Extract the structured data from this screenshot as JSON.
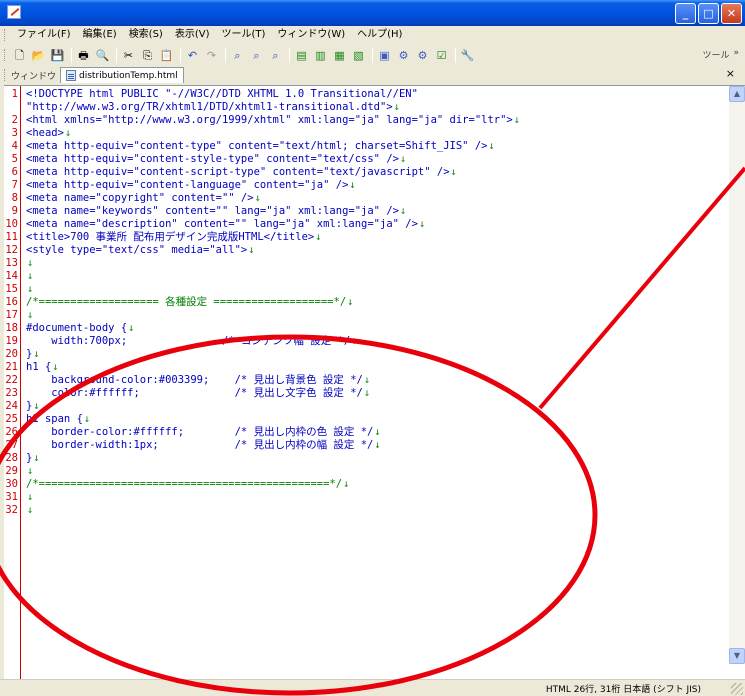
{
  "menu": [
    "ファイル(F)",
    "編集(E)",
    "検索(S)",
    "表示(V)",
    "ツール(T)",
    "ウィンドウ(W)",
    "ヘルプ(H)"
  ],
  "toolbar": {
    "right_label": "ツール",
    "right_more": "»"
  },
  "tabbar": {
    "label": "ウィンドウ",
    "tab_title": "distributionTemp.html",
    "close": "×"
  },
  "editor_lines": [
    {
      "n": "1",
      "t": "<!DOCTYPE html PUBLIC \"-//W3C//DTD XHTML 1.0 Transitional//EN\"",
      "eol": ""
    },
    {
      "n": "",
      "t": "\"http://www.w3.org/TR/xhtml1/DTD/xhtml1-transitional.dtd\">",
      "eol": "↓"
    },
    {
      "n": "2",
      "t": "<html xmlns=\"http://www.w3.org/1999/xhtml\" xml:lang=\"ja\" lang=\"ja\" dir=\"ltr\">",
      "eol": "↓"
    },
    {
      "n": "3",
      "t": "<head>",
      "eol": "↓"
    },
    {
      "n": "4",
      "t": "<meta http-equiv=\"content-type\" content=\"text/html; charset=Shift_JIS\" />",
      "eol": "↓"
    },
    {
      "n": "5",
      "t": "<meta http-equiv=\"content-style-type\" content=\"text/css\" />",
      "eol": "↓"
    },
    {
      "n": "6",
      "t": "<meta http-equiv=\"content-script-type\" content=\"text/javascript\" />",
      "eol": "↓"
    },
    {
      "n": "7",
      "t": "<meta http-equiv=\"content-language\" content=\"ja\" />",
      "eol": "↓"
    },
    {
      "n": "8",
      "t": "<meta name=\"copyright\" content=\"\" />",
      "eol": "↓"
    },
    {
      "n": "9",
      "t": "<meta name=\"keywords\" content=\"\" lang=\"ja\" xml:lang=\"ja\" />",
      "eol": "↓"
    },
    {
      "n": "10",
      "t": "<meta name=\"description\" content=\"\" lang=\"ja\" xml:lang=\"ja\" />",
      "eol": "↓"
    },
    {
      "n": "11",
      "t": "<title>700 事業所 配布用デザイン完成版HTML</title>",
      "eol": "↓"
    },
    {
      "n": "12",
      "t": "<style type=\"text/css\" media=\"all\">",
      "eol": "↓"
    },
    {
      "n": "13",
      "t": "",
      "eol": "↓"
    },
    {
      "n": "14",
      "t": "",
      "eol": "↓"
    },
    {
      "n": "15",
      "t": "",
      "eol": "↓"
    },
    {
      "n": "16",
      "t": "/*=================== 各種設定 ===================*/",
      "eol": "↓"
    },
    {
      "n": "17",
      "t": "",
      "eol": "↓"
    },
    {
      "n": "18",
      "t": "#document-body {",
      "eol": "↓"
    },
    {
      "n": "19",
      "t": "    width:700px;               /* コンテンツ幅 設定 */",
      "eol": "↓"
    },
    {
      "n": "20",
      "t": "}",
      "eol": "↓"
    },
    {
      "n": "21",
      "t": "h1 {",
      "eol": "↓"
    },
    {
      "n": "22",
      "t": "    background-color:#003399;    /* 見出し背景色 設定 */",
      "eol": "↓"
    },
    {
      "n": "23",
      "t": "    color:#ffffff;               /* 見出し文字色 設定 */",
      "eol": "↓"
    },
    {
      "n": "24",
      "t": "}",
      "eol": "↓"
    },
    {
      "n": "25",
      "t": "h1 span {",
      "eol": "↓"
    },
    {
      "n": "26",
      "t": "    border-color:#ffffff;        /* 見出し内枠の色 設定 */",
      "eol": "↓"
    },
    {
      "n": "27",
      "t": "    border-width:1px;            /* 見出し内枠の幅 設定 */",
      "eol": "↓"
    },
    {
      "n": "28",
      "t": "}",
      "eol": "↓"
    },
    {
      "n": "29",
      "t": "",
      "eol": "↓"
    },
    {
      "n": "30",
      "t": "/*==============================================*/",
      "eol": "↓"
    },
    {
      "n": "31",
      "t": "",
      "eol": "↓"
    },
    {
      "n": "32",
      "t": "",
      "eol": "↓"
    }
  ],
  "status": "HTML  26行, 31桁  日本語 (シフト JIS)",
  "colors": {
    "annotation": "#e8000c",
    "line_numbers": "#d00000",
    "code": "#0000c0",
    "eol_marker": "#1a8a1a"
  }
}
